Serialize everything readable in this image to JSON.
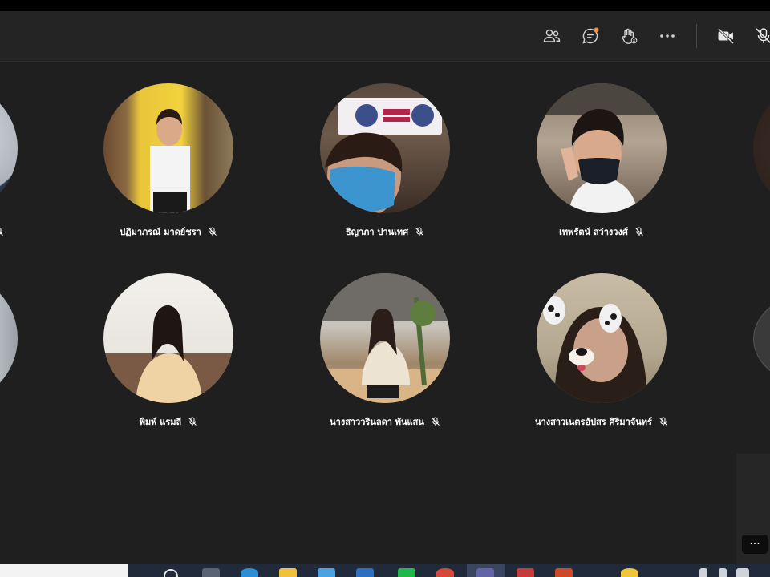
{
  "toolbar": {
    "buttons": [
      {
        "name": "participants-icon"
      },
      {
        "name": "chat-icon"
      },
      {
        "name": "raise-hand-icon"
      },
      {
        "name": "more-options-icon"
      },
      {
        "name": "camera-off-icon"
      },
      {
        "name": "mic-off-icon"
      }
    ],
    "accent": "#ff8c37"
  },
  "participants": {
    "row1": [
      {
        "name": ""
      },
      {
        "name": "ปฏิมาภรณ์ มาดย์ชรา"
      },
      {
        "name": "ธิญาภา ปานเทศ"
      },
      {
        "name": "เทพรัตน์ สว่างวงศ์"
      },
      {
        "name": ""
      }
    ],
    "row2": [
      {
        "name": ""
      },
      {
        "name": "พิมพ์ แรมลี"
      },
      {
        "name": "นางสาววรินลดา พันแสน"
      },
      {
        "name": "นางสาวเนตรอัปสร ศิริมาจันทร์"
      },
      {
        "name": ""
      }
    ]
  },
  "overflow": {
    "label": "···"
  },
  "colors": {
    "background": "#1f1f1f",
    "toolbar": "#242424",
    "taskbar": "#202a3a"
  }
}
